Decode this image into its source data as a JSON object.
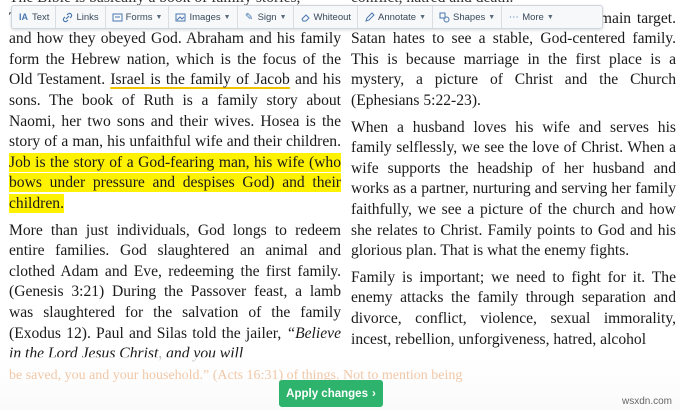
{
  "toolbar": {
    "items": [
      {
        "label": "Text",
        "icon": "text-icon",
        "caret": false
      },
      {
        "label": "Links",
        "icon": "link-icon",
        "caret": false
      },
      {
        "label": "Forms",
        "icon": "form-icon",
        "caret": true
      },
      {
        "label": "Images",
        "icon": "image-icon",
        "caret": true
      },
      {
        "label": "Sign",
        "icon": "pen-icon",
        "caret": true
      },
      {
        "label": "Whiteout",
        "icon": "eraser-icon",
        "caret": false
      },
      {
        "label": "Annotate",
        "icon": "annotate-icon",
        "caret": true
      },
      {
        "label": "Shapes",
        "icon": "shapes-icon",
        "caret": true
      },
      {
        "label": "More",
        "icon": "ellipsis-icon",
        "caret": true
      }
    ]
  },
  "document": {
    "left": {
      "top_fragment": "The Bible is basically a book of family stories,",
      "p1a": "The great stories of the Bible tell us about families and how they obeyed God. Abraham and his family form the Hebrew nation, which is the focus of the Old Testament. ",
      "p1_underlined": "Israel is the family of Jacob",
      "p1b": " and his sons. The book of Ruth is a family story about Naomi, her two sons and their wives. Hosea is the story of a man, his unfaithful wife and their children. ",
      "p1_highlight": "Job is the story of a God-fearing man, his wife (who bows under pressure and despises God) and their children.",
      "p2a": "More than just individuals, God longs to redeem entire families. God slaughtered an animal and clothed Adam and Eve, redeeming the first family. (Genesis 3:21) During the Passover feast, a lamb was slaughtered for the salvation of the family (Exodus 12). Paul and Silas told the jailer, ",
      "p2_italic": "“Believe in the Lord Jesus Christ, and you will"
    },
    "right": {
      "top_fragment": "conflict, hatred and death.",
      "p1": "We are at war, with the family as the main target. Satan hates to see a stable, God-centered family. This is because marriage in the first place is a mystery, a picture of Christ and the Church (Ephesians 5:22-23).",
      "p2": "When a husband loves his wife and serves his family selflessly, we see the love of Christ. When a wife supports the headship of her husband and works as a partner, nurturing and serving her family faithfully, we see a picture of the church and how she relates to Christ. Family points to God and his glorious plan. That is what the enemy fights.",
      "p3": "Family is important; we need to fight for it. The enemy attacks the family through separation and divorce, conflict, violence, sexual immorality, incest, rebellion, unforgiveness, hatred, alcohol"
    },
    "faded_bottom": "be saved, you and your household.” (Acts 16:31)          of things. Not to mention being"
  },
  "apply_button": {
    "label": "Apply changes",
    "icon": "chevron-right-icon"
  },
  "watermark": "wsxdn.com",
  "colors": {
    "apply": "#2db36b",
    "highlight": "#fff200",
    "underline": "#f2c400",
    "toolbar_icon": "#4a78b0"
  }
}
